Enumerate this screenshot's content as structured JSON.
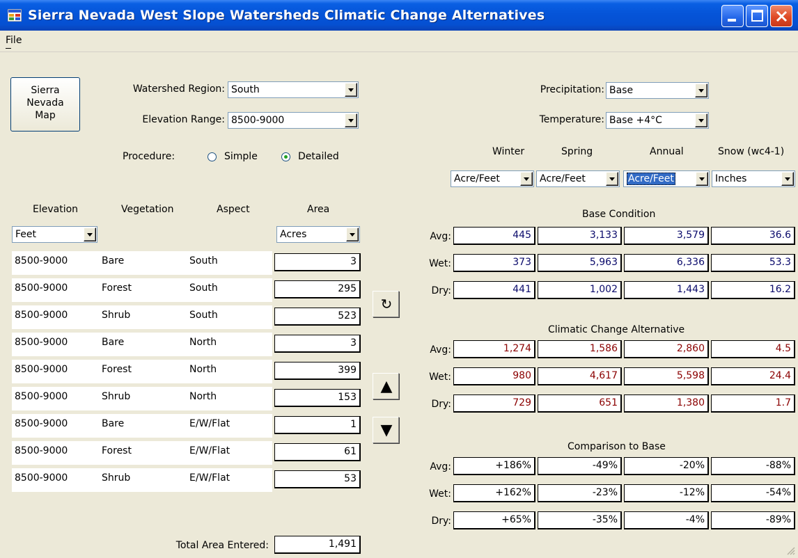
{
  "window": {
    "title": "Sierra Nevada West Slope Watersheds Climatic Change Alternatives"
  },
  "menu": {
    "file": "File"
  },
  "map_button": {
    "label": "Sierra\nNevada\nMap"
  },
  "watershed": {
    "label": "Watershed Region:",
    "value": "South"
  },
  "elevation_range": {
    "label": "Elevation Range:",
    "value": "8500-9000"
  },
  "procedure": {
    "label": "Procedure:",
    "simple": "Simple",
    "detailed": "Detailed",
    "selected": "Detailed"
  },
  "precipitation": {
    "label": "Precipitation:",
    "value": "Base"
  },
  "temperature": {
    "label": "Temperature:",
    "value": "Base +4°C"
  },
  "columns": {
    "winter": "Winter",
    "spring": "Spring",
    "annual": "Annual",
    "snow": "Snow (wc4-1)"
  },
  "units": {
    "winter": "Acre/Feet",
    "spring": "Acre/Feet",
    "annual": "Acre/Feet",
    "snow": "Inches"
  },
  "left_headers": {
    "elevation": "Elevation",
    "vegetation": "Vegetation",
    "aspect": "Aspect",
    "area": "Area"
  },
  "left_units": {
    "elevation": "Feet",
    "area": "Acres"
  },
  "rows": [
    {
      "elev": "8500-9000",
      "veg": "Bare",
      "aspect": "South",
      "area": "3"
    },
    {
      "elev": "8500-9000",
      "veg": "Forest",
      "aspect": "South",
      "area": "295"
    },
    {
      "elev": "8500-9000",
      "veg": "Shrub",
      "aspect": "South",
      "area": "523"
    },
    {
      "elev": "8500-9000",
      "veg": "Bare",
      "aspect": "North",
      "area": "3"
    },
    {
      "elev": "8500-9000",
      "veg": "Forest",
      "aspect": "North",
      "area": "399"
    },
    {
      "elev": "8500-9000",
      "veg": "Shrub",
      "aspect": "North",
      "area": "153"
    },
    {
      "elev": "8500-9000",
      "veg": "Bare",
      "aspect": "E/W/Flat",
      "area": "1"
    },
    {
      "elev": "8500-9000",
      "veg": "Forest",
      "aspect": "E/W/Flat",
      "area": "61"
    },
    {
      "elev": "8500-9000",
      "veg": "Shrub",
      "aspect": "E/W/Flat",
      "area": "53"
    }
  ],
  "total": {
    "label": "Total Area Entered:",
    "value": "1,491"
  },
  "row_labels": {
    "avg": "Avg:",
    "wet": "Wet:",
    "dry": "Dry:"
  },
  "base": {
    "title": "Base Condition",
    "avg": [
      "445",
      "3,133",
      "3,579",
      "36.6"
    ],
    "wet": [
      "373",
      "5,963",
      "6,336",
      "53.3"
    ],
    "dry": [
      "441",
      "1,002",
      "1,443",
      "16.2"
    ]
  },
  "alt": {
    "title": "Climatic Change Alternative",
    "avg": [
      "1,274",
      "1,586",
      "2,860",
      "4.5"
    ],
    "wet": [
      "980",
      "4,617",
      "5,598",
      "24.4"
    ],
    "dry": [
      "729",
      "651",
      "1,380",
      "1.7"
    ]
  },
  "cmp": {
    "title": "Comparison to Base",
    "avg": [
      "+186%",
      "-49%",
      "-20%",
      "-88%"
    ],
    "wet": [
      "+162%",
      "-23%",
      "-12%",
      "-54%"
    ],
    "dry": [
      "+65%",
      "-35%",
      "-4%",
      "-89%"
    ]
  },
  "icons": {
    "refresh": "↻",
    "up": "▲",
    "down": "▼"
  },
  "colors": {
    "titlebar": "#0554d8",
    "base_values": "#0a0a6b",
    "alt_values": "#8b0000",
    "window_bg": "#ece9d8"
  }
}
